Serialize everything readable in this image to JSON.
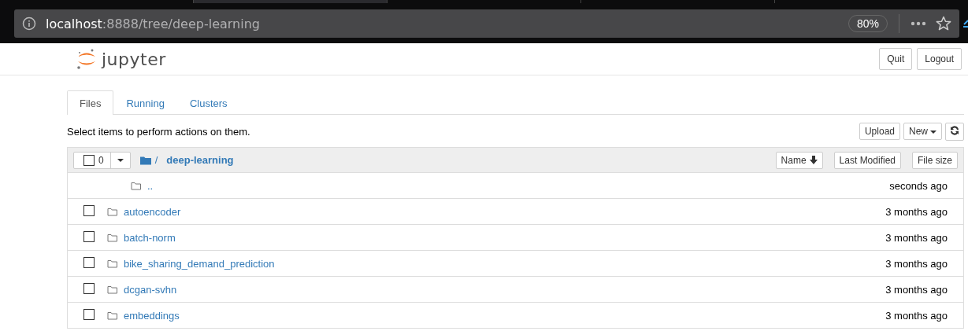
{
  "browser": {
    "url_host": "localhost",
    "url_path": ":8888/tree/deep-learning",
    "zoom": "80%"
  },
  "header": {
    "logo_text": "jupyter",
    "buttons": [
      "Quit",
      "Logout"
    ]
  },
  "tabs": [
    {
      "label": "Files",
      "selected": true
    },
    {
      "label": "Running",
      "selected": false
    },
    {
      "label": "Clusters",
      "selected": false
    }
  ],
  "hint": "Select items to perform actions on them.",
  "toolbar": {
    "buttons": [
      "Upload",
      "New"
    ]
  },
  "list_header": {
    "selected_count": "0",
    "breadcrumb_sep": "/",
    "folder": "deep-learning",
    "sort_buttons": [
      {
        "label": "Name",
        "sorted": true
      },
      {
        "label": "Last Modified",
        "sorted": false
      },
      {
        "label": "File size",
        "sorted": false
      }
    ]
  },
  "rows": [
    {
      "kind": "parent",
      "name": "..",
      "modified": "seconds ago"
    },
    {
      "kind": "folder",
      "name": "autoencoder",
      "modified": "3 months ago",
      "checked": false
    },
    {
      "kind": "folder",
      "name": "batch-norm",
      "modified": "3 months ago",
      "checked": false
    },
    {
      "kind": "folder",
      "name": "bike_sharing_demand_prediction",
      "modified": "3 months ago",
      "checked": false
    },
    {
      "kind": "folder",
      "name": "dcgan-svhn",
      "modified": "3 months ago",
      "checked": false
    },
    {
      "kind": "folder",
      "name": "embeddings",
      "modified": "3 months ago",
      "checked": false
    }
  ]
}
